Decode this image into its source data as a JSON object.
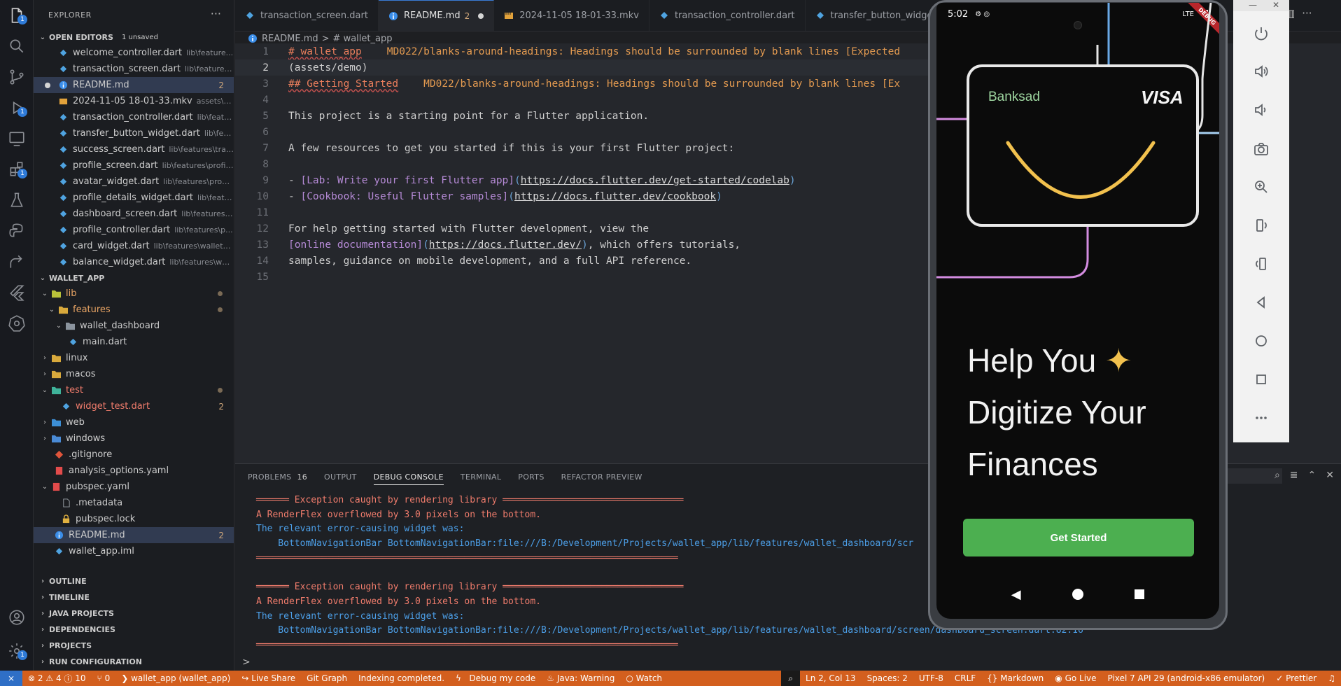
{
  "sidebar": {
    "title": "EXPLORER",
    "open_editors": {
      "label": "OPEN EDITORS",
      "unsaved": "1 unsaved",
      "files": [
        {
          "name": "welcome_controller.dart",
          "path": "lib\\feature..."
        },
        {
          "name": "transaction_screen.dart",
          "path": "lib\\features\\..."
        },
        {
          "name": "README.md",
          "count": "2"
        },
        {
          "name": "2024-11-05 18-01-33.mkv",
          "path": "assets\\d..."
        },
        {
          "name": "transaction_controller.dart",
          "path": "lib\\featu..."
        },
        {
          "name": "transfer_button_widget.dart",
          "path": "lib\\feat..."
        },
        {
          "name": "success_screen.dart",
          "path": "lib\\features\\tran..."
        },
        {
          "name": "profile_screen.dart",
          "path": "lib\\features\\profil..."
        },
        {
          "name": "avatar_widget.dart",
          "path": "lib\\features\\profil..."
        },
        {
          "name": "profile_details_widget.dart",
          "path": "lib\\featu..."
        },
        {
          "name": "dashboard_screen.dart",
          "path": "lib\\features\\..."
        },
        {
          "name": "profile_controller.dart",
          "path": "lib\\features\\p..."
        },
        {
          "name": "card_widget.dart",
          "path": "lib\\features\\wallet_..."
        },
        {
          "name": "balance_widget.dart",
          "path": "lib\\features\\wal..."
        }
      ]
    },
    "project": {
      "label": "WALLET_APP",
      "tree": [
        {
          "name": "lib"
        },
        {
          "name": "features"
        },
        {
          "name": "wallet_dashboard"
        },
        {
          "name": "main.dart"
        },
        {
          "name": "linux"
        },
        {
          "name": "macos"
        },
        {
          "name": "test"
        },
        {
          "name": "widget_test.dart",
          "count": "2"
        },
        {
          "name": "web"
        },
        {
          "name": "windows"
        },
        {
          "name": ".gitignore"
        },
        {
          "name": "analysis_options.yaml"
        },
        {
          "name": "pubspec.yaml"
        },
        {
          "name": ".metadata"
        },
        {
          "name": "pubspec.lock"
        },
        {
          "name": "README.md",
          "count": "2"
        },
        {
          "name": "wallet_app.iml"
        }
      ]
    },
    "sections": [
      "OUTLINE",
      "TIMELINE",
      "JAVA PROJECTS",
      "DEPENDENCIES",
      "PROJECTS",
      "RUN CONFIGURATION"
    ]
  },
  "tabs": [
    {
      "label": "transaction_screen.dart"
    },
    {
      "label": "README.md",
      "count": "2"
    },
    {
      "label": "2024-11-05 18-01-33.mkv"
    },
    {
      "label": "transaction_controller.dart"
    },
    {
      "label": "transfer_button_widget.dart"
    }
  ],
  "breadcrumb": {
    "file": "README.md",
    "sep": ">",
    "symbol": "# wallet_app"
  },
  "editor": {
    "line_numbers": [
      "1",
      "2",
      "3",
      "4",
      "5",
      "6",
      "7",
      "8",
      "9",
      "10",
      "11",
      "12",
      "13",
      "14",
      "15"
    ],
    "l1_heading": "# wallet_app",
    "l1_diag": "MD022/blanks-around-headings: Headings should be surrounded by blank lines [Expected",
    "l2": "(assets/demo)",
    "l3_heading": "## Getting Started",
    "l3_diag": "MD022/blanks-around-headings: Headings should be surrounded by blank lines [Ex",
    "l5": "This project is a starting point for a Flutter application.",
    "l7": "A few resources to get you started if this is your first Flutter project:",
    "l9_dash": "- ",
    "l9_text": "[Lab: Write your first Flutter app]",
    "l9_url": "https://docs.flutter.dev/get-started/codelab",
    "l10_dash": "- ",
    "l10_text": "[Cookbook: Useful Flutter samples]",
    "l10_url": "https://docs.flutter.dev/cookbook",
    "l12": "For help getting started with Flutter development, view the",
    "l13_text": "[online documentation]",
    "l13_url": "https://docs.flutter.dev/",
    "l13_rest": ", which offers tutorials,",
    "l14": "samples, guidance on mobile development, and a full API reference."
  },
  "panel": {
    "tabs": [
      "PROBLEMS",
      "OUTPUT",
      "DEBUG CONSOLE",
      "TERMINAL",
      "PORTS",
      "REFACTOR PREVIEW"
    ],
    "problems_count": "16",
    "console": [
      {
        "kind": "sep",
        "text": "══════ Exception caught by rendering library ═════════════════════════════════"
      },
      {
        "kind": "err",
        "text": "A RenderFlex overflowed by 3.0 pixels on the bottom."
      },
      {
        "kind": "info",
        "text": "The relevant error-causing widget was:"
      },
      {
        "kind": "info",
        "text": "    BottomNavigationBar BottomNavigationBar:file:///B:/Development/Projects/wallet_app/lib/features/wallet_dashboard/scr"
      },
      {
        "kind": "sep",
        "text": "═════════════════════════════════════════════════════════════════════════════"
      },
      {
        "kind": "blank",
        "text": " "
      },
      {
        "kind": "sep",
        "text": "══════ Exception caught by rendering library ═════════════════════════════════"
      },
      {
        "kind": "err",
        "text": "A RenderFlex overflowed by 3.0 pixels on the bottom."
      },
      {
        "kind": "info",
        "text": "The relevant error-causing widget was:"
      },
      {
        "kind": "info",
        "text": "    BottomNavigationBar BottomNavigationBar:file:///B:/Development/Projects/wallet_app/lib/features/wallet_dashboard/screen/dashboard_screen.dart:82:16"
      },
      {
        "kind": "sep",
        "text": "═════════════════════════════════════════════════════════════════════════════"
      }
    ],
    "prompt": ">"
  },
  "status": {
    "errors": "2",
    "warnings": "4",
    "info": "10",
    "ports": "0",
    "project": "wallet_app (wallet_app)",
    "live_share": "Live Share",
    "git_graph": "Git Graph",
    "indexing": "Indexing completed.",
    "debug": "Debug my code",
    "java": "Java: Warning",
    "watch": "Watch",
    "position": "Ln 2, Col 13",
    "spaces": "Spaces: 2",
    "encoding": "UTF-8",
    "eol": "CRLF",
    "language": "Markdown",
    "golive": "Go Live",
    "device": "Pixel 7 API 29 (android-x86 emulator)",
    "prettier": "Prettier"
  },
  "phone": {
    "time": "5:02",
    "network": "LTE",
    "debug_ribbon": "DEBUG",
    "card_brand": "Banksad",
    "card_network": "VISA",
    "hero_line1": "Help You",
    "hero_sparkle": "✦",
    "hero_line2": "Digitize Your",
    "hero_line3": "Finances",
    "cta": "Get Started"
  },
  "colors": {
    "status_bar": "#d35f1e",
    "accent_green": "#4caf50",
    "smile": "#f2c14e"
  }
}
